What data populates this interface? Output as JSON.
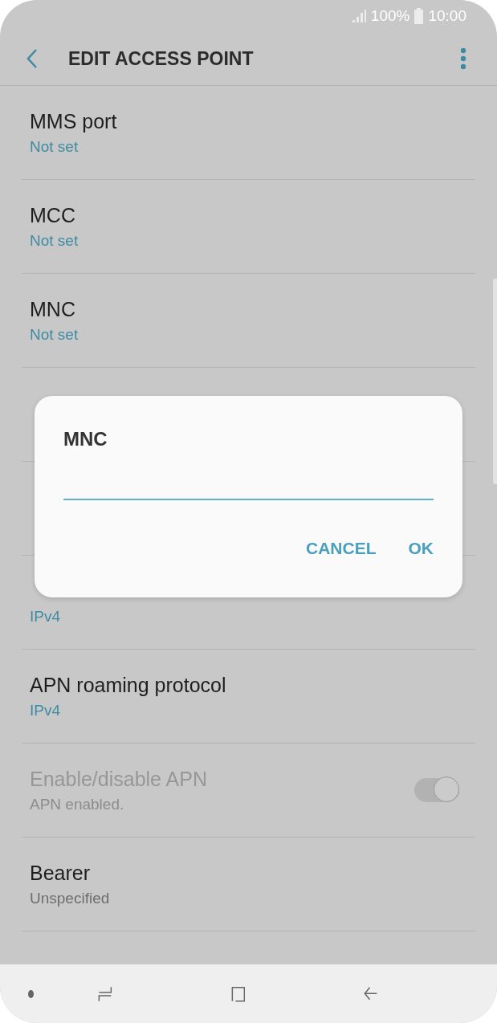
{
  "status_bar": {
    "battery": "100%",
    "time": "10:00"
  },
  "header": {
    "title": "EDIT ACCESS POINT"
  },
  "rows": [
    {
      "kind": "value",
      "title": "MMS port",
      "value": "Not set",
      "highlighted": true,
      "disabled": false
    },
    {
      "kind": "value",
      "title": "MCC",
      "value": "Not set",
      "highlighted": true,
      "disabled": false
    },
    {
      "kind": "value",
      "title": "MNC",
      "value": "Not set",
      "highlighted": true,
      "disabled": false
    },
    {
      "kind": "covered"
    },
    {
      "kind": "covered"
    },
    {
      "kind": "value",
      "value": "IPv4",
      "highlighted": true,
      "disabled": false
    },
    {
      "kind": "value",
      "title": "APN roaming protocol",
      "value": "IPv4",
      "highlighted": true,
      "disabled": false
    },
    {
      "kind": "toggle",
      "title": "Enable/disable APN",
      "value": "APN enabled.",
      "disabled": true,
      "on": true
    },
    {
      "kind": "value",
      "title": "Bearer",
      "value": "Unspecified",
      "highlighted": false,
      "disabled": false
    }
  ],
  "dialog": {
    "title": "MNC",
    "buttons": [
      "CANCEL",
      "OK"
    ]
  }
}
